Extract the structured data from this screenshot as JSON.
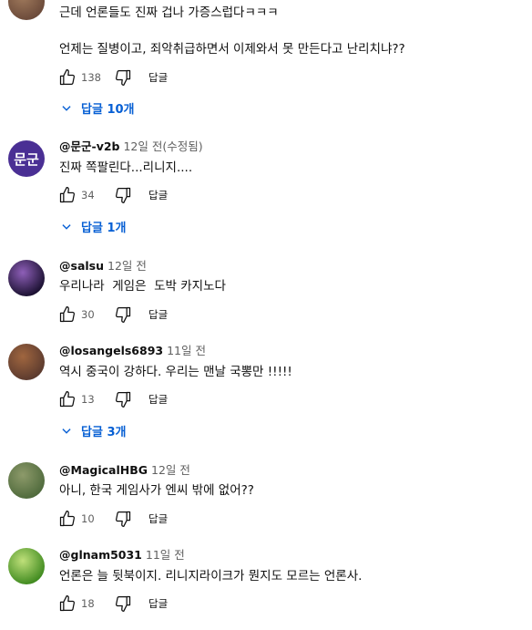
{
  "comments": [
    {
      "author": "",
      "time": "",
      "body": "근데 언론들도 진짜 겁나 가증스럽다ㅋㅋㅋ\n\n언제는 질병이고, 죄악취급하면서 이제와서 못 만든다고 난리치냐??",
      "likes": "138",
      "reply_label": "답글",
      "replies": "답글 10개",
      "avatar_colors": [
        "#6b4a3a",
        "#a07a5c"
      ]
    },
    {
      "author": "@문군-v2b",
      "time": "12일 전(수정됨)",
      "body": "진짜 쪽팔린다...리니지....",
      "likes": "34",
      "reply_label": "답글",
      "replies": "답글 1개",
      "avatar_text": "문군",
      "avatar_colors": [
        "#4a2f94",
        "#4a2f94"
      ]
    },
    {
      "author": "@salsu",
      "time": "12일 전",
      "body": "우리나라  게임은  도박 카지노다",
      "likes": "30",
      "reply_label": "답글",
      "avatar_colors": [
        "#1a1030",
        "#8e5fb8"
      ]
    },
    {
      "author": "@losangels6893",
      "time": "11일 전",
      "body": "역시 중국이 강하다. 우리는 맨날 국뽕만 !!!!!",
      "likes": "13",
      "reply_label": "답글",
      "replies": "답글 3개",
      "avatar_colors": [
        "#5b3a2e",
        "#a0663f"
      ]
    },
    {
      "author": "@MagicalHBG",
      "time": "12일 전",
      "body": "아니, 한국 게임사가 엔씨 밖에 없어??",
      "likes": "10",
      "reply_label": "답글",
      "avatar_colors": [
        "#4f6a3c",
        "#8d9a6a"
      ]
    },
    {
      "author": "@glnam5031",
      "time": "11일 전",
      "body": "언론은 늘 뒷북이지. 리니지라이크가 뭔지도 모르는 언론사.",
      "likes": "18",
      "reply_label": "답글",
      "avatar_colors": [
        "#3f8a1f",
        "#bfe07a"
      ]
    }
  ],
  "colors": {
    "link": "#065fd4",
    "meta": "#606060",
    "text": "#0f0f0f"
  },
  "icons": {
    "like": "thumb-up-icon",
    "dislike": "thumb-down-icon",
    "expand": "chevron-down-icon"
  }
}
